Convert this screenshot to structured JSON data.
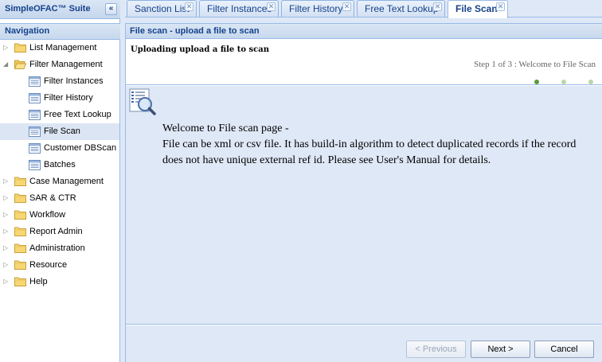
{
  "app": {
    "suite_title": "SimpleOFAC™ Suite",
    "collapse_glyph": "«"
  },
  "navigation": {
    "title": "Navigation",
    "items": [
      {
        "label": "List Management",
        "expanded": false
      },
      {
        "label": "Filter Management",
        "expanded": true,
        "children": [
          {
            "label": "Filter Instances"
          },
          {
            "label": "Filter History"
          },
          {
            "label": "Free Text Lookup"
          },
          {
            "label": "File Scan",
            "selected": true
          },
          {
            "label": "Customer DBScan"
          },
          {
            "label": "Batches"
          }
        ]
      },
      {
        "label": "Case Management",
        "expanded": false
      },
      {
        "label": "SAR & CTR",
        "expanded": false
      },
      {
        "label": "Workflow",
        "expanded": false
      },
      {
        "label": "Report Admin",
        "expanded": false
      },
      {
        "label": "Administration",
        "expanded": false
      },
      {
        "label": "Resource",
        "expanded": false
      },
      {
        "label": "Help",
        "expanded": false
      }
    ]
  },
  "tabs": [
    {
      "label": "Sanction List"
    },
    {
      "label": "Filter Instances"
    },
    {
      "label": "Filter History"
    },
    {
      "label": "Free Text Lookup"
    },
    {
      "label": "File Scan",
      "active": true
    }
  ],
  "panel": {
    "title": "File scan - upload a file to scan",
    "heading": "Uploading upload a file to scan",
    "step_text": "Step 1 of 3 : Welcome to File Scan",
    "steps_total": 3,
    "current_step": 1,
    "welcome_line": "Welcome to File scan page -",
    "description": "File can be xml or csv file. It has build-in algorithm to detect duplicated records if the record does not have unique external ref id. Please see User's Manual for details."
  },
  "buttons": {
    "previous": "< Previous",
    "next": "Next >",
    "cancel": "Cancel"
  },
  "colors": {
    "header_text": "#15428b",
    "border": "#99bbe8",
    "step_active": "#5a9a3a",
    "step_inactive": "#b9d6a8"
  },
  "icons": {
    "folder": "folder-icon",
    "leaf": "document-list-icon",
    "scan": "file-scan-magnifier-icon",
    "tab_close": "close-icon"
  }
}
